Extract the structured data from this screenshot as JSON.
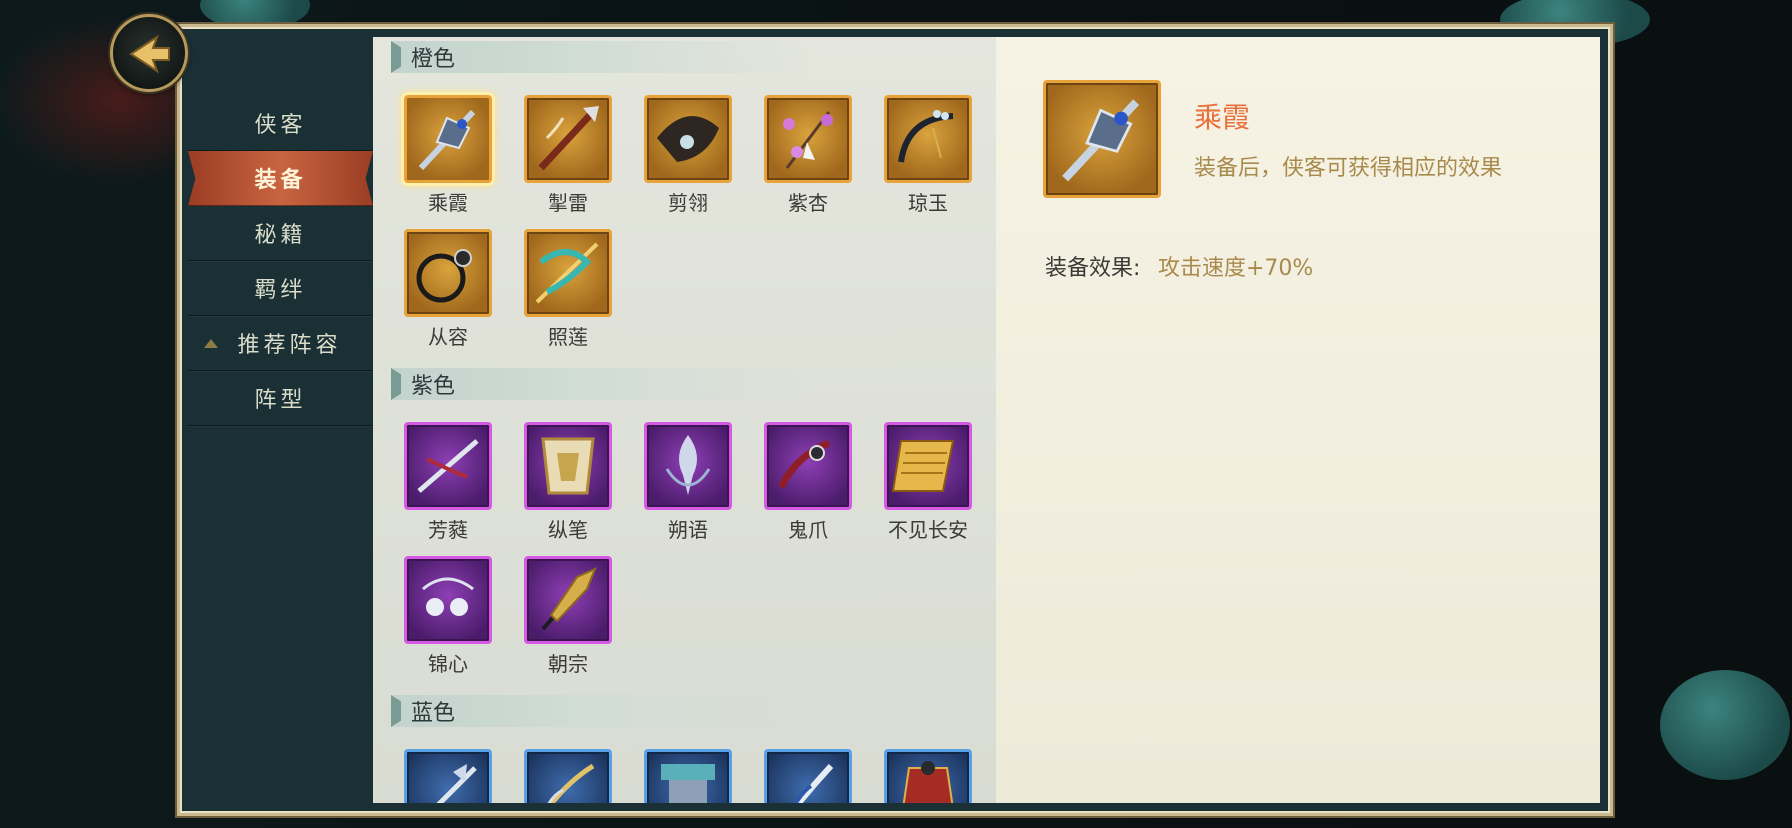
{
  "nav": {
    "back_icon": "back-arrow-icon",
    "items": [
      {
        "label": "侠客"
      },
      {
        "label": "装备"
      },
      {
        "label": "秘籍"
      },
      {
        "label": "羁绊"
      },
      {
        "label": "推荐阵容"
      },
      {
        "label": "阵型"
      }
    ],
    "active_index": 1
  },
  "sections": [
    {
      "title": "橙色",
      "rarity": "orange",
      "items": [
        {
          "name": "乘霞",
          "icon": "staff-weapon-icon"
        },
        {
          "name": "掣雷",
          "icon": "spear-weapon-icon"
        },
        {
          "name": "剪翎",
          "icon": "fan-weapon-icon"
        },
        {
          "name": "紫杏",
          "icon": "flower-brush-icon"
        },
        {
          "name": "琼玉",
          "icon": "jade-whip-icon"
        },
        {
          "name": "从容",
          "icon": "ring-chain-icon"
        },
        {
          "name": "照莲",
          "icon": "ribbon-blade-icon"
        }
      ]
    },
    {
      "title": "紫色",
      "rarity": "purple",
      "items": [
        {
          "name": "芳蕤",
          "icon": "twin-blade-icon"
        },
        {
          "name": "纵笔",
          "icon": "armor-plate-icon"
        },
        {
          "name": "朔语",
          "icon": "spirit-icon"
        },
        {
          "name": "鬼爪",
          "icon": "claw-icon"
        },
        {
          "name": "不见长安",
          "icon": "scroll-icon"
        },
        {
          "name": "锦心",
          "icon": "bell-charm-icon"
        },
        {
          "name": "朝宗",
          "icon": "spearhead-icon"
        }
      ]
    },
    {
      "title": "蓝色",
      "rarity": "blue",
      "items": [
        {
          "name": "",
          "icon": "halberd-icon"
        },
        {
          "name": "",
          "icon": "brush-icon"
        },
        {
          "name": "",
          "icon": "armor-icon"
        },
        {
          "name": "",
          "icon": "blade-icon"
        },
        {
          "name": "",
          "icon": "robe-icon"
        }
      ]
    }
  ],
  "selected": {
    "name": "乘霞",
    "icon": "staff-weapon-icon",
    "description": "装备后，侠客可获得相应的效果",
    "effect_label": "装备效果:",
    "effect_value": "攻击速度+70%"
  },
  "colors": {
    "orange_border": "#e7a33a",
    "purple_border": "#d45ae4",
    "blue_border": "#5aa0e6",
    "active_nav": "#c86440",
    "item_name_highlight": "#e8703a",
    "detail_text": "#a88a4c"
  }
}
